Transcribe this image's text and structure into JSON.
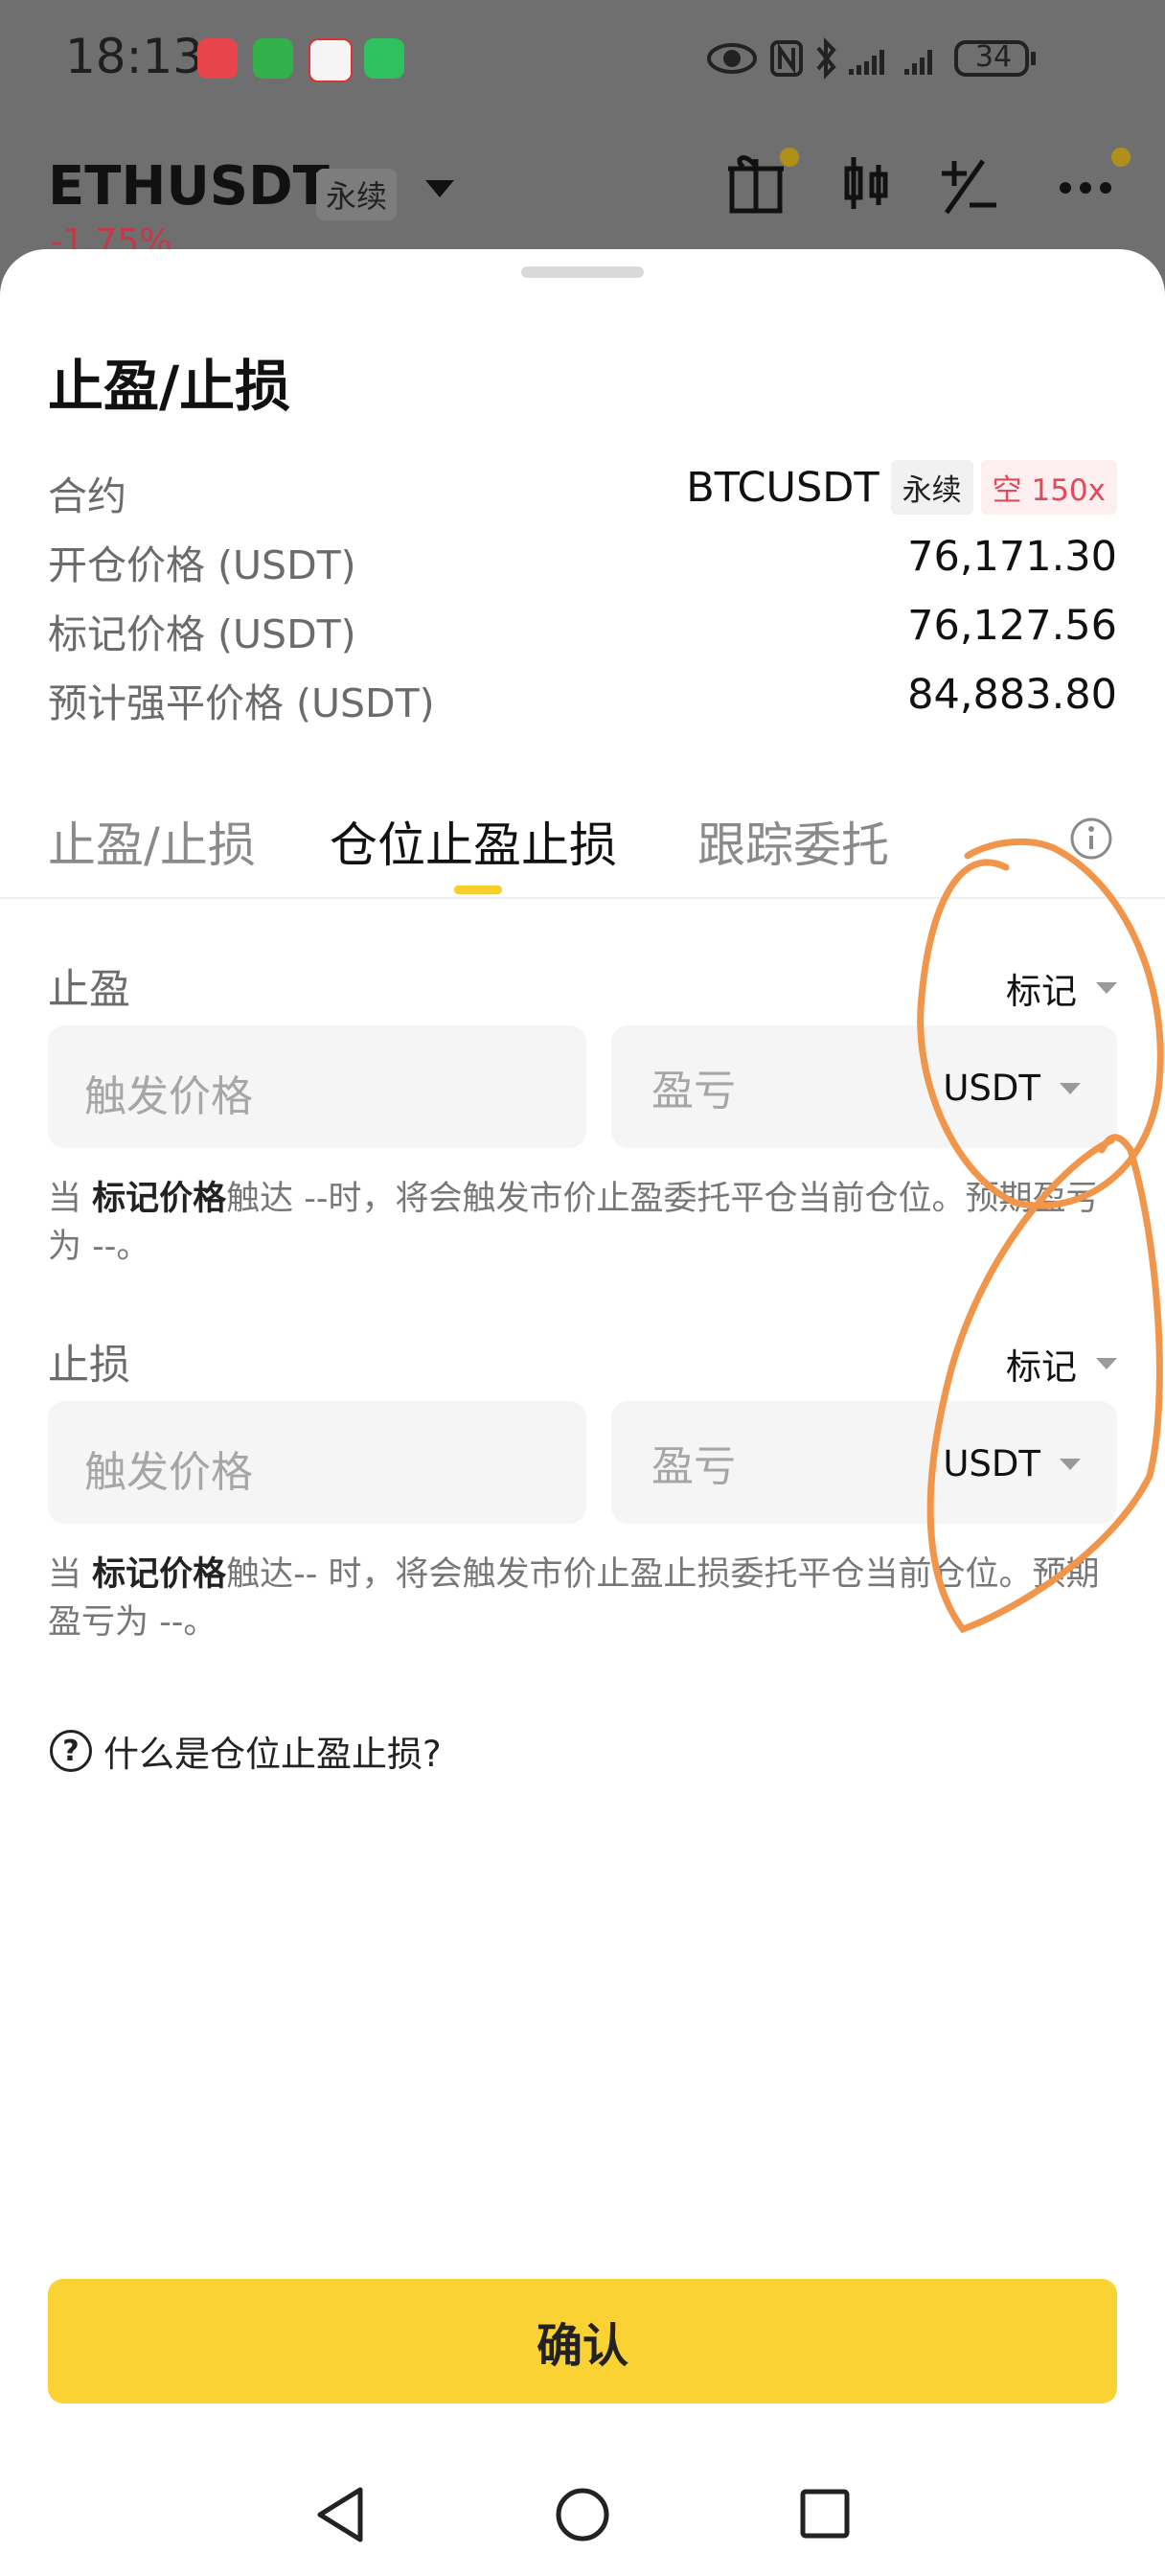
{
  "status_bar": {
    "time": "18:13",
    "battery": "34"
  },
  "background": {
    "symbol": "ETHUSDT",
    "contract_type": "永续",
    "change": "-1.75%"
  },
  "sheet": {
    "title": "止盈/止损",
    "info_rows": [
      {
        "label": "合约",
        "value": "BTCUSDT",
        "tag1": "永续",
        "tag2": "空 150x"
      },
      {
        "label": "开仓价格 (USDT)",
        "value": "76,171.30"
      },
      {
        "label": "标记价格 (USDT)",
        "value": "76,127.56"
      },
      {
        "label": "预计强平价格 (USDT)",
        "value": "84,883.80"
      }
    ],
    "tabs": [
      {
        "label": "止盈/止损"
      },
      {
        "label": "仓位止盈止损"
      },
      {
        "label": "跟踪委托"
      }
    ],
    "take_profit": {
      "label": "止盈",
      "price_type": "标记",
      "trigger_placeholder": "触发价格",
      "pnl_placeholder": "盈亏",
      "unit": "USDT",
      "hint_prefix": "当 ",
      "hint_bold": "标记价格",
      "hint_rest": "触达 --时，将会触发市价止盈委托平仓当前仓位。预期盈亏为 --。"
    },
    "stop_loss": {
      "label": "止损",
      "price_type": "标记",
      "trigger_placeholder": "触发价格",
      "pnl_placeholder": "盈亏",
      "unit": "USDT",
      "hint_prefix": "当 ",
      "hint_bold": "标记价格",
      "hint_rest": "触达-- 时，将会触发市价止盈止损委托平仓当前仓位。预期盈亏为 --。"
    },
    "help_link": "什么是仓位止盈止损?",
    "confirm_label": "确认"
  },
  "colors": {
    "accent_yellow": "#fad233",
    "short_red": "#e04a5a",
    "annotation_orange": "#f0954a"
  }
}
